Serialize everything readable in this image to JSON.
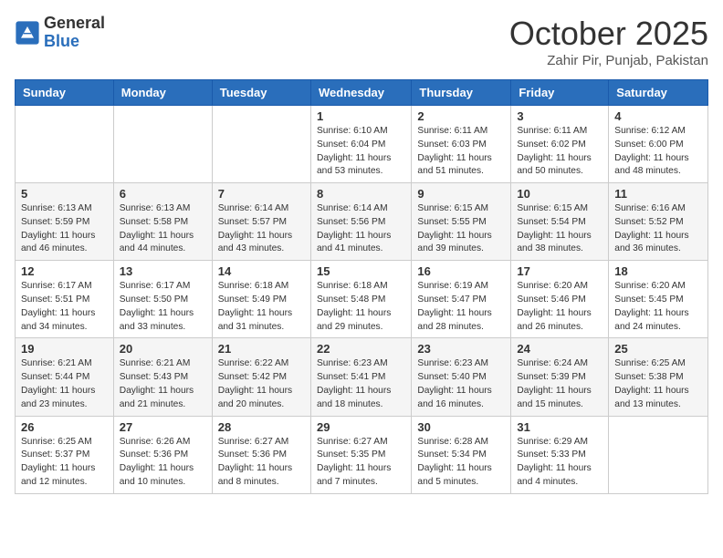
{
  "header": {
    "logo_general": "General",
    "logo_blue": "Blue",
    "month_title": "October 2025",
    "location": "Zahir Pir, Punjab, Pakistan"
  },
  "weekdays": [
    "Sunday",
    "Monday",
    "Tuesday",
    "Wednesday",
    "Thursday",
    "Friday",
    "Saturday"
  ],
  "weeks": [
    [
      {
        "day": "",
        "info": ""
      },
      {
        "day": "",
        "info": ""
      },
      {
        "day": "",
        "info": ""
      },
      {
        "day": "1",
        "info": "Sunrise: 6:10 AM\nSunset: 6:04 PM\nDaylight: 11 hours\nand 53 minutes."
      },
      {
        "day": "2",
        "info": "Sunrise: 6:11 AM\nSunset: 6:03 PM\nDaylight: 11 hours\nand 51 minutes."
      },
      {
        "day": "3",
        "info": "Sunrise: 6:11 AM\nSunset: 6:02 PM\nDaylight: 11 hours\nand 50 minutes."
      },
      {
        "day": "4",
        "info": "Sunrise: 6:12 AM\nSunset: 6:00 PM\nDaylight: 11 hours\nand 48 minutes."
      }
    ],
    [
      {
        "day": "5",
        "info": "Sunrise: 6:13 AM\nSunset: 5:59 PM\nDaylight: 11 hours\nand 46 minutes."
      },
      {
        "day": "6",
        "info": "Sunrise: 6:13 AM\nSunset: 5:58 PM\nDaylight: 11 hours\nand 44 minutes."
      },
      {
        "day": "7",
        "info": "Sunrise: 6:14 AM\nSunset: 5:57 PM\nDaylight: 11 hours\nand 43 minutes."
      },
      {
        "day": "8",
        "info": "Sunrise: 6:14 AM\nSunset: 5:56 PM\nDaylight: 11 hours\nand 41 minutes."
      },
      {
        "day": "9",
        "info": "Sunrise: 6:15 AM\nSunset: 5:55 PM\nDaylight: 11 hours\nand 39 minutes."
      },
      {
        "day": "10",
        "info": "Sunrise: 6:15 AM\nSunset: 5:54 PM\nDaylight: 11 hours\nand 38 minutes."
      },
      {
        "day": "11",
        "info": "Sunrise: 6:16 AM\nSunset: 5:52 PM\nDaylight: 11 hours\nand 36 minutes."
      }
    ],
    [
      {
        "day": "12",
        "info": "Sunrise: 6:17 AM\nSunset: 5:51 PM\nDaylight: 11 hours\nand 34 minutes."
      },
      {
        "day": "13",
        "info": "Sunrise: 6:17 AM\nSunset: 5:50 PM\nDaylight: 11 hours\nand 33 minutes."
      },
      {
        "day": "14",
        "info": "Sunrise: 6:18 AM\nSunset: 5:49 PM\nDaylight: 11 hours\nand 31 minutes."
      },
      {
        "day": "15",
        "info": "Sunrise: 6:18 AM\nSunset: 5:48 PM\nDaylight: 11 hours\nand 29 minutes."
      },
      {
        "day": "16",
        "info": "Sunrise: 6:19 AM\nSunset: 5:47 PM\nDaylight: 11 hours\nand 28 minutes."
      },
      {
        "day": "17",
        "info": "Sunrise: 6:20 AM\nSunset: 5:46 PM\nDaylight: 11 hours\nand 26 minutes."
      },
      {
        "day": "18",
        "info": "Sunrise: 6:20 AM\nSunset: 5:45 PM\nDaylight: 11 hours\nand 24 minutes."
      }
    ],
    [
      {
        "day": "19",
        "info": "Sunrise: 6:21 AM\nSunset: 5:44 PM\nDaylight: 11 hours\nand 23 minutes."
      },
      {
        "day": "20",
        "info": "Sunrise: 6:21 AM\nSunset: 5:43 PM\nDaylight: 11 hours\nand 21 minutes."
      },
      {
        "day": "21",
        "info": "Sunrise: 6:22 AM\nSunset: 5:42 PM\nDaylight: 11 hours\nand 20 minutes."
      },
      {
        "day": "22",
        "info": "Sunrise: 6:23 AM\nSunset: 5:41 PM\nDaylight: 11 hours\nand 18 minutes."
      },
      {
        "day": "23",
        "info": "Sunrise: 6:23 AM\nSunset: 5:40 PM\nDaylight: 11 hours\nand 16 minutes."
      },
      {
        "day": "24",
        "info": "Sunrise: 6:24 AM\nSunset: 5:39 PM\nDaylight: 11 hours\nand 15 minutes."
      },
      {
        "day": "25",
        "info": "Sunrise: 6:25 AM\nSunset: 5:38 PM\nDaylight: 11 hours\nand 13 minutes."
      }
    ],
    [
      {
        "day": "26",
        "info": "Sunrise: 6:25 AM\nSunset: 5:37 PM\nDaylight: 11 hours\nand 12 minutes."
      },
      {
        "day": "27",
        "info": "Sunrise: 6:26 AM\nSunset: 5:36 PM\nDaylight: 11 hours\nand 10 minutes."
      },
      {
        "day": "28",
        "info": "Sunrise: 6:27 AM\nSunset: 5:36 PM\nDaylight: 11 hours\nand 8 minutes."
      },
      {
        "day": "29",
        "info": "Sunrise: 6:27 AM\nSunset: 5:35 PM\nDaylight: 11 hours\nand 7 minutes."
      },
      {
        "day": "30",
        "info": "Sunrise: 6:28 AM\nSunset: 5:34 PM\nDaylight: 11 hours\nand 5 minutes."
      },
      {
        "day": "31",
        "info": "Sunrise: 6:29 AM\nSunset: 5:33 PM\nDaylight: 11 hours\nand 4 minutes."
      },
      {
        "day": "",
        "info": ""
      }
    ]
  ]
}
